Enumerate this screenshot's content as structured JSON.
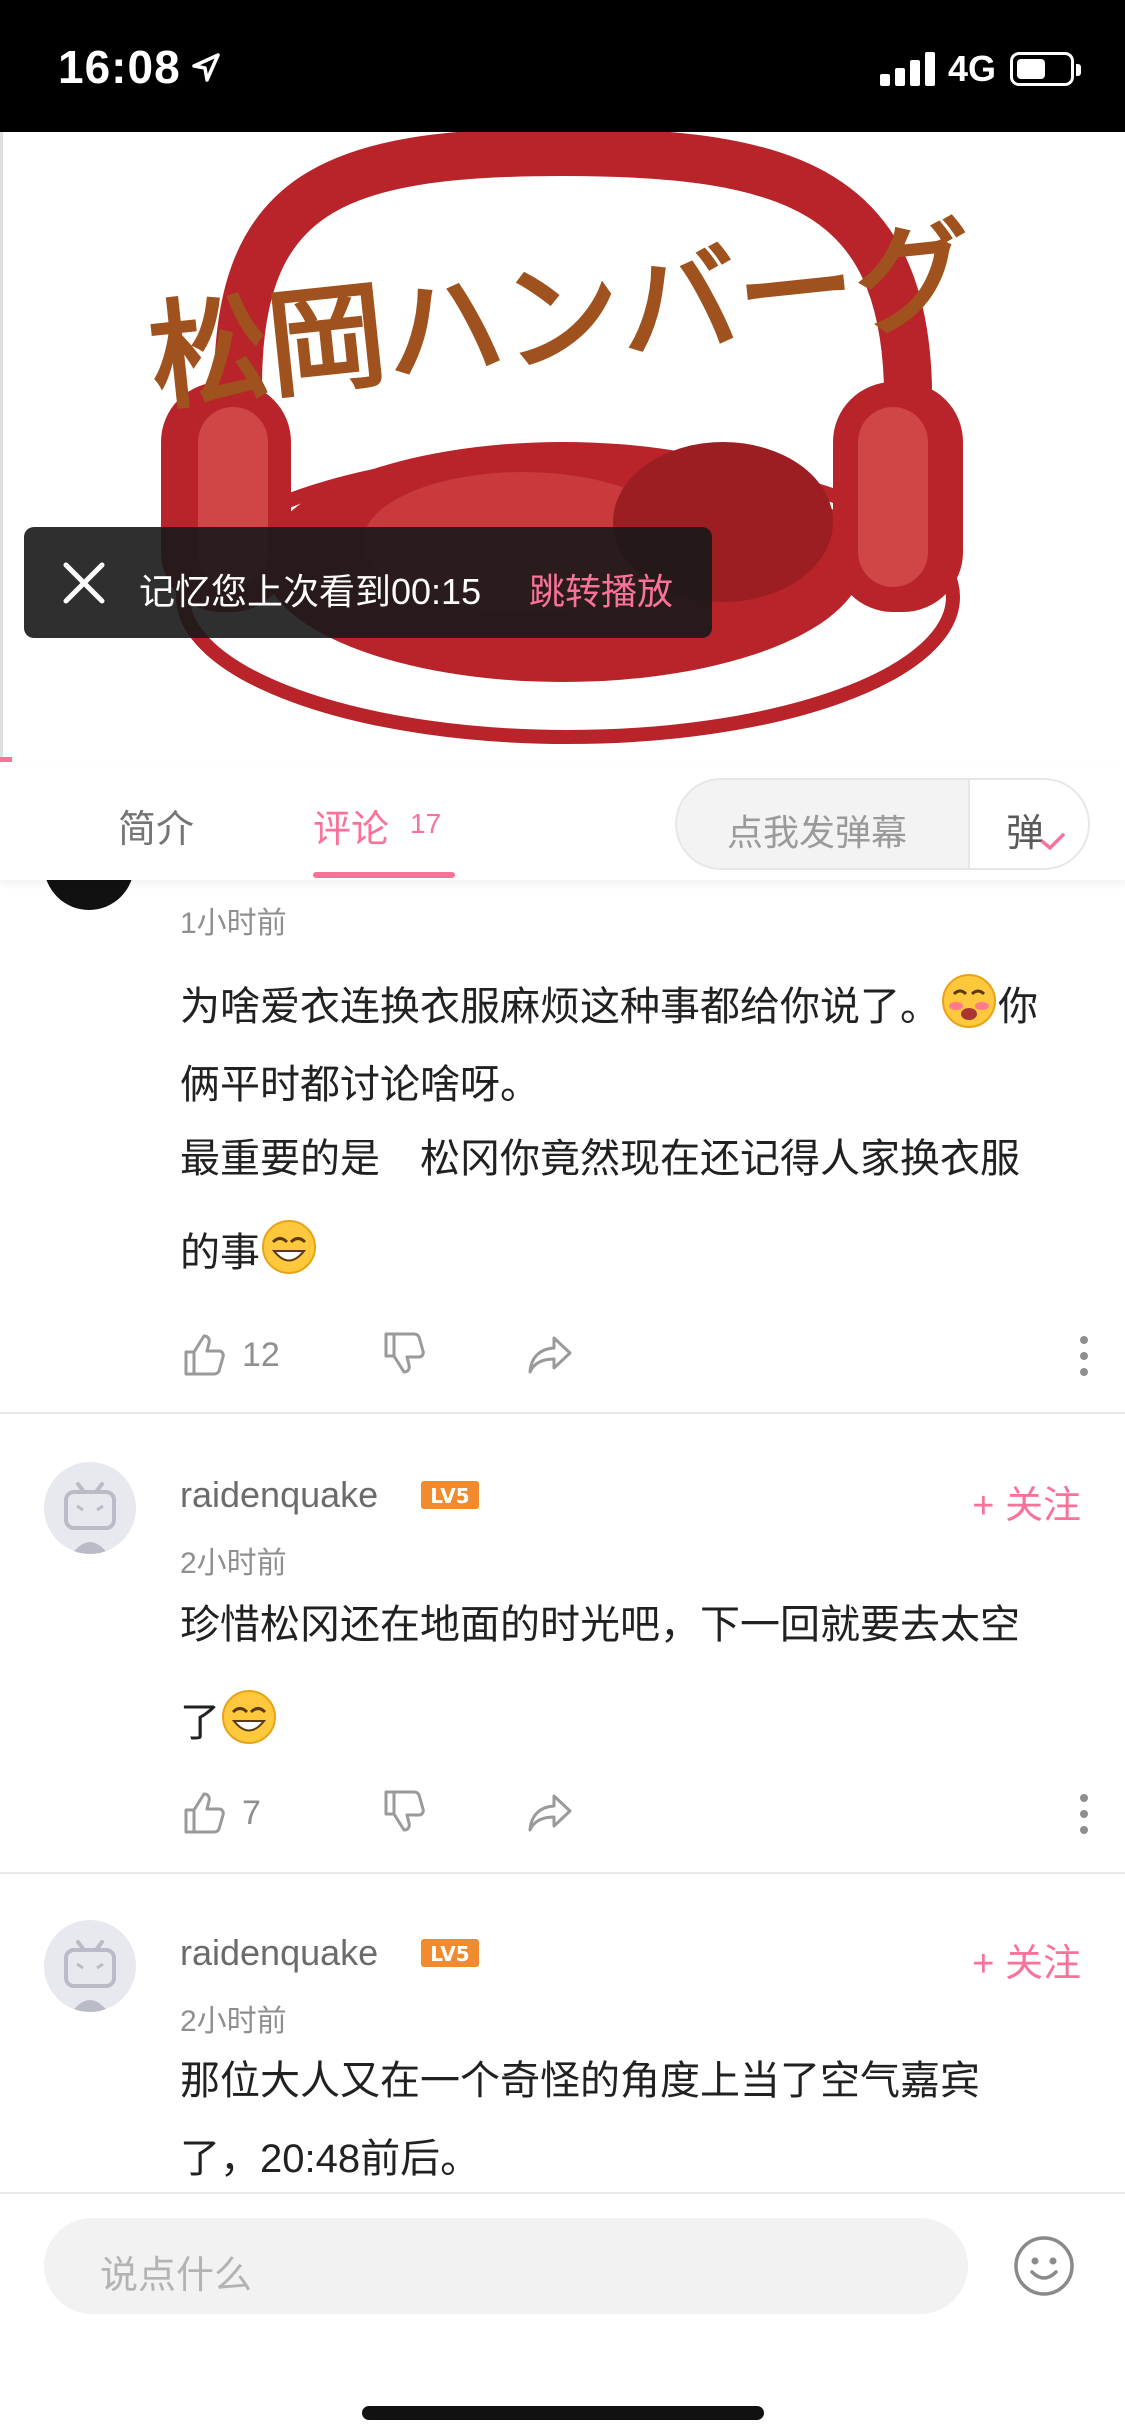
{
  "status_bar": {
    "time": "16:08",
    "network": "4G",
    "battery_level": 0.55
  },
  "video": {
    "logo_text": "松岡ハンバーグ"
  },
  "resume_toast": {
    "text": "记忆您上次看到00:15",
    "jump_label": "跳转播放"
  },
  "tabs": [
    {
      "label": "简介"
    },
    {
      "label": "评论",
      "count": "17"
    }
  ],
  "danmaku": {
    "placeholder": "点我发弹幕",
    "toggle_label": "弹"
  },
  "comments": [
    {
      "time": "1小时前",
      "lines": [
        "为啥爱衣连换衣服麻烦这种事都给你说了。",
        "你",
        "俩平时都讨论啥呀。",
        "最重要的是　松冈你竟然现在还记得人家换衣服",
        "的事"
      ],
      "likes": "12"
    },
    {
      "username": "raidenquake",
      "level": "LV5",
      "follow": "+ 关注",
      "time": "2小时前",
      "lines": [
        "珍惜松冈还在地面的时光吧，下一回就要去太空",
        "了"
      ],
      "likes": "7"
    },
    {
      "username": "raidenquake",
      "level": "LV5",
      "follow": "+ 关注",
      "time": "2小时前",
      "lines": [
        "那位大人又在一个奇怪的角度上当了空气嘉宾",
        "了，20:48前后。"
      ]
    }
  ],
  "input": {
    "placeholder": "说点什么"
  },
  "colors": {
    "accent": "#fb7299",
    "logo_red": "#b8242a",
    "logo_text": "#a0521e",
    "level_orange": "#f28a2e"
  }
}
